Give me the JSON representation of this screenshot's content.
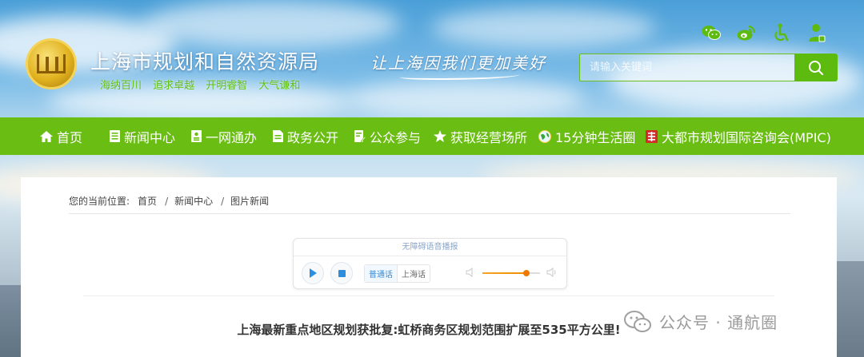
{
  "header": {
    "site_title": "上海市规划和自然资源局",
    "site_subtitle": "海纳百川 追求卓越 开明睿智 大气谦和",
    "slogan": "让上海因我们更加美好",
    "top_icons": [
      "wechat-icon",
      "weibo-icon",
      "accessibility-icon",
      "user-icon"
    ],
    "search": {
      "placeholder": "请输入关键词",
      "value": ""
    }
  },
  "nav": {
    "items": [
      {
        "label": "首页",
        "icon": "home-icon"
      },
      {
        "label": "新闻中心",
        "icon": "news-icon"
      },
      {
        "label": "一网通办",
        "icon": "service-icon"
      },
      {
        "label": "政务公开",
        "icon": "document-icon"
      },
      {
        "label": "公众参与",
        "icon": "participate-icon"
      },
      {
        "label": "获取经营场所",
        "icon": "star-icon"
      },
      {
        "label": "15分钟生活圈",
        "icon": "globe-icon"
      },
      {
        "label": "大都市规划国际咨询会(MPIC)",
        "icon": "mpic-icon"
      }
    ]
  },
  "breadcrumb": {
    "prefix": "您的当前位置:",
    "items": [
      "首页",
      "新闻中心",
      "图片新闻"
    ],
    "separator": "/"
  },
  "player": {
    "title": "无障碍语音播报",
    "languages": [
      "普通话",
      "上海话"
    ],
    "active_language": "普通话",
    "volume": 0.75
  },
  "article": {
    "title": "上海最新重点地区规划获批复:虹桥商务区规划范围扩展至535平方公里!"
  },
  "watermark": {
    "text": "公众号 · 通航圈"
  },
  "colors": {
    "nav_green": "#6abd12",
    "subtitle_green": "#5fc10e",
    "accent_orange": "#f08c00",
    "link_blue": "#2d8ee0"
  }
}
